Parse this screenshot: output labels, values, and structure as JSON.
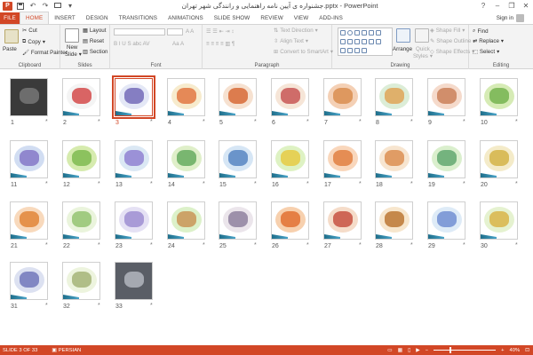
{
  "window": {
    "title": "جشنواره ی آیین نامه راهنمایی و رانندگی شهر تهران.pptx - PowerPoint",
    "app_badge": "P",
    "controls": [
      "?",
      "–",
      "❐",
      "✕"
    ]
  },
  "tabs": [
    "FILE",
    "HOME",
    "INSERT",
    "DESIGN",
    "TRANSITIONS",
    "ANIMATIONS",
    "SLIDE SHOW",
    "REVIEW",
    "VIEW",
    "ADD-INS"
  ],
  "active_tab": "HOME",
  "signin": "Sign in",
  "ribbon": {
    "clipboard": {
      "label": "Clipboard",
      "paste": "Paste",
      "cut": "Cut",
      "copy": "Copy",
      "format_painter": "Format Painter"
    },
    "slides": {
      "label": "Slides",
      "new_slide": "New",
      "new_slide2": "Slide",
      "layout": "Layout",
      "reset": "Reset",
      "section": "Section"
    },
    "font": {
      "label": "Font"
    },
    "paragraph": {
      "label": "Paragraph",
      "text_direction": "Text Direction",
      "align_text": "Align Text",
      "convert": "Convert to SmartArt"
    },
    "drawing": {
      "label": "Drawing",
      "arrange": "Arrange",
      "quick_styles": "Quick",
      "quick_styles2": "Styles",
      "shape_fill": "Shape Fill",
      "shape_outline": "Shape Outline",
      "shape_effects": "Shape Effects"
    },
    "editing": {
      "label": "Editing",
      "find": "Find",
      "replace": "Replace",
      "select": "Select"
    }
  },
  "slides": [
    {
      "n": "1",
      "c1": "#3a3a3a",
      "c2": "#7a7a7a",
      "photo": true
    },
    {
      "n": "2",
      "c1": "#f2f2f2",
      "c2": "#d24040"
    },
    {
      "n": "3",
      "c1": "#dfe4f5",
      "c2": "#6d63b5",
      "selected": true
    },
    {
      "n": "4",
      "c1": "#f6e7c4",
      "c2": "#e0703a"
    },
    {
      "n": "5",
      "c1": "#f4dcc8",
      "c2": "#d6632d"
    },
    {
      "n": "6",
      "c1": "#f5e0d0",
      "c2": "#c54d4d"
    },
    {
      "n": "7",
      "c1": "#f2c8a8",
      "c2": "#d88a4a"
    },
    {
      "n": "8",
      "c1": "#d6ead0",
      "c2": "#e0a050"
    },
    {
      "n": "9",
      "c1": "#f3d3c2",
      "c2": "#c87a52"
    },
    {
      "n": "10",
      "c1": "#cfe7a8",
      "c2": "#6fb04a"
    },
    {
      "n": "11",
      "c1": "#c9d7f0",
      "c2": "#7f72c4"
    },
    {
      "n": "12",
      "c1": "#cfe8a0",
      "c2": "#79b84a"
    },
    {
      "n": "13",
      "c1": "#d5e4f2",
      "c2": "#8b7bd0"
    },
    {
      "n": "14",
      "c1": "#d9ecc0",
      "c2": "#5fa85a"
    },
    {
      "n": "15",
      "c1": "#cfe2f3",
      "c2": "#4f7fbf"
    },
    {
      "n": "16",
      "c1": "#d8f0b8",
      "c2": "#e6c83c"
    },
    {
      "n": "17",
      "c1": "#f8d0b0",
      "c2": "#e07a3a"
    },
    {
      "n": "18",
      "c1": "#f6e0c8",
      "c2": "#d98a4a"
    },
    {
      "n": "19",
      "c1": "#d4ecc4",
      "c2": "#5aa46a"
    },
    {
      "n": "20",
      "c1": "#f2e8c0",
      "c2": "#d2b040"
    },
    {
      "n": "21",
      "c1": "#f7d2b0",
      "c2": "#e08030"
    },
    {
      "n": "22",
      "c1": "#e6f2d6",
      "c2": "#8ec06a"
    },
    {
      "n": "23",
      "c1": "#e0dcf2",
      "c2": "#9a8ad0"
    },
    {
      "n": "24",
      "c1": "#d6eec0",
      "c2": "#c89050"
    },
    {
      "n": "25",
      "c1": "#e8e0e8",
      "c2": "#8a7a9a"
    },
    {
      "n": "26",
      "c1": "#f6c8a0",
      "c2": "#e06a2a"
    },
    {
      "n": "27",
      "c1": "#f3d6c0",
      "c2": "#c44a3a"
    },
    {
      "n": "28",
      "c1": "#f6e2c4",
      "c2": "#b8702a"
    },
    {
      "n": "29",
      "c1": "#d8e8f6",
      "c2": "#6a8ad0"
    },
    {
      "n": "30",
      "c1": "#e0f0c8",
      "c2": "#d8b040"
    },
    {
      "n": "31",
      "c1": "#d6dcef",
      "c2": "#6a70b8"
    },
    {
      "n": "32",
      "c1": "#eaf2d8",
      "c2": "#a0b070"
    },
    {
      "n": "33",
      "c1": "#5a5e66",
      "c2": "#b8bcc4",
      "photo": true
    }
  ],
  "star": "*",
  "status": {
    "slide": "SLIDE 3 OF 33",
    "language": "PERSIAN",
    "zoom": "40%"
  },
  "colors": {
    "accent": "#d24726"
  }
}
